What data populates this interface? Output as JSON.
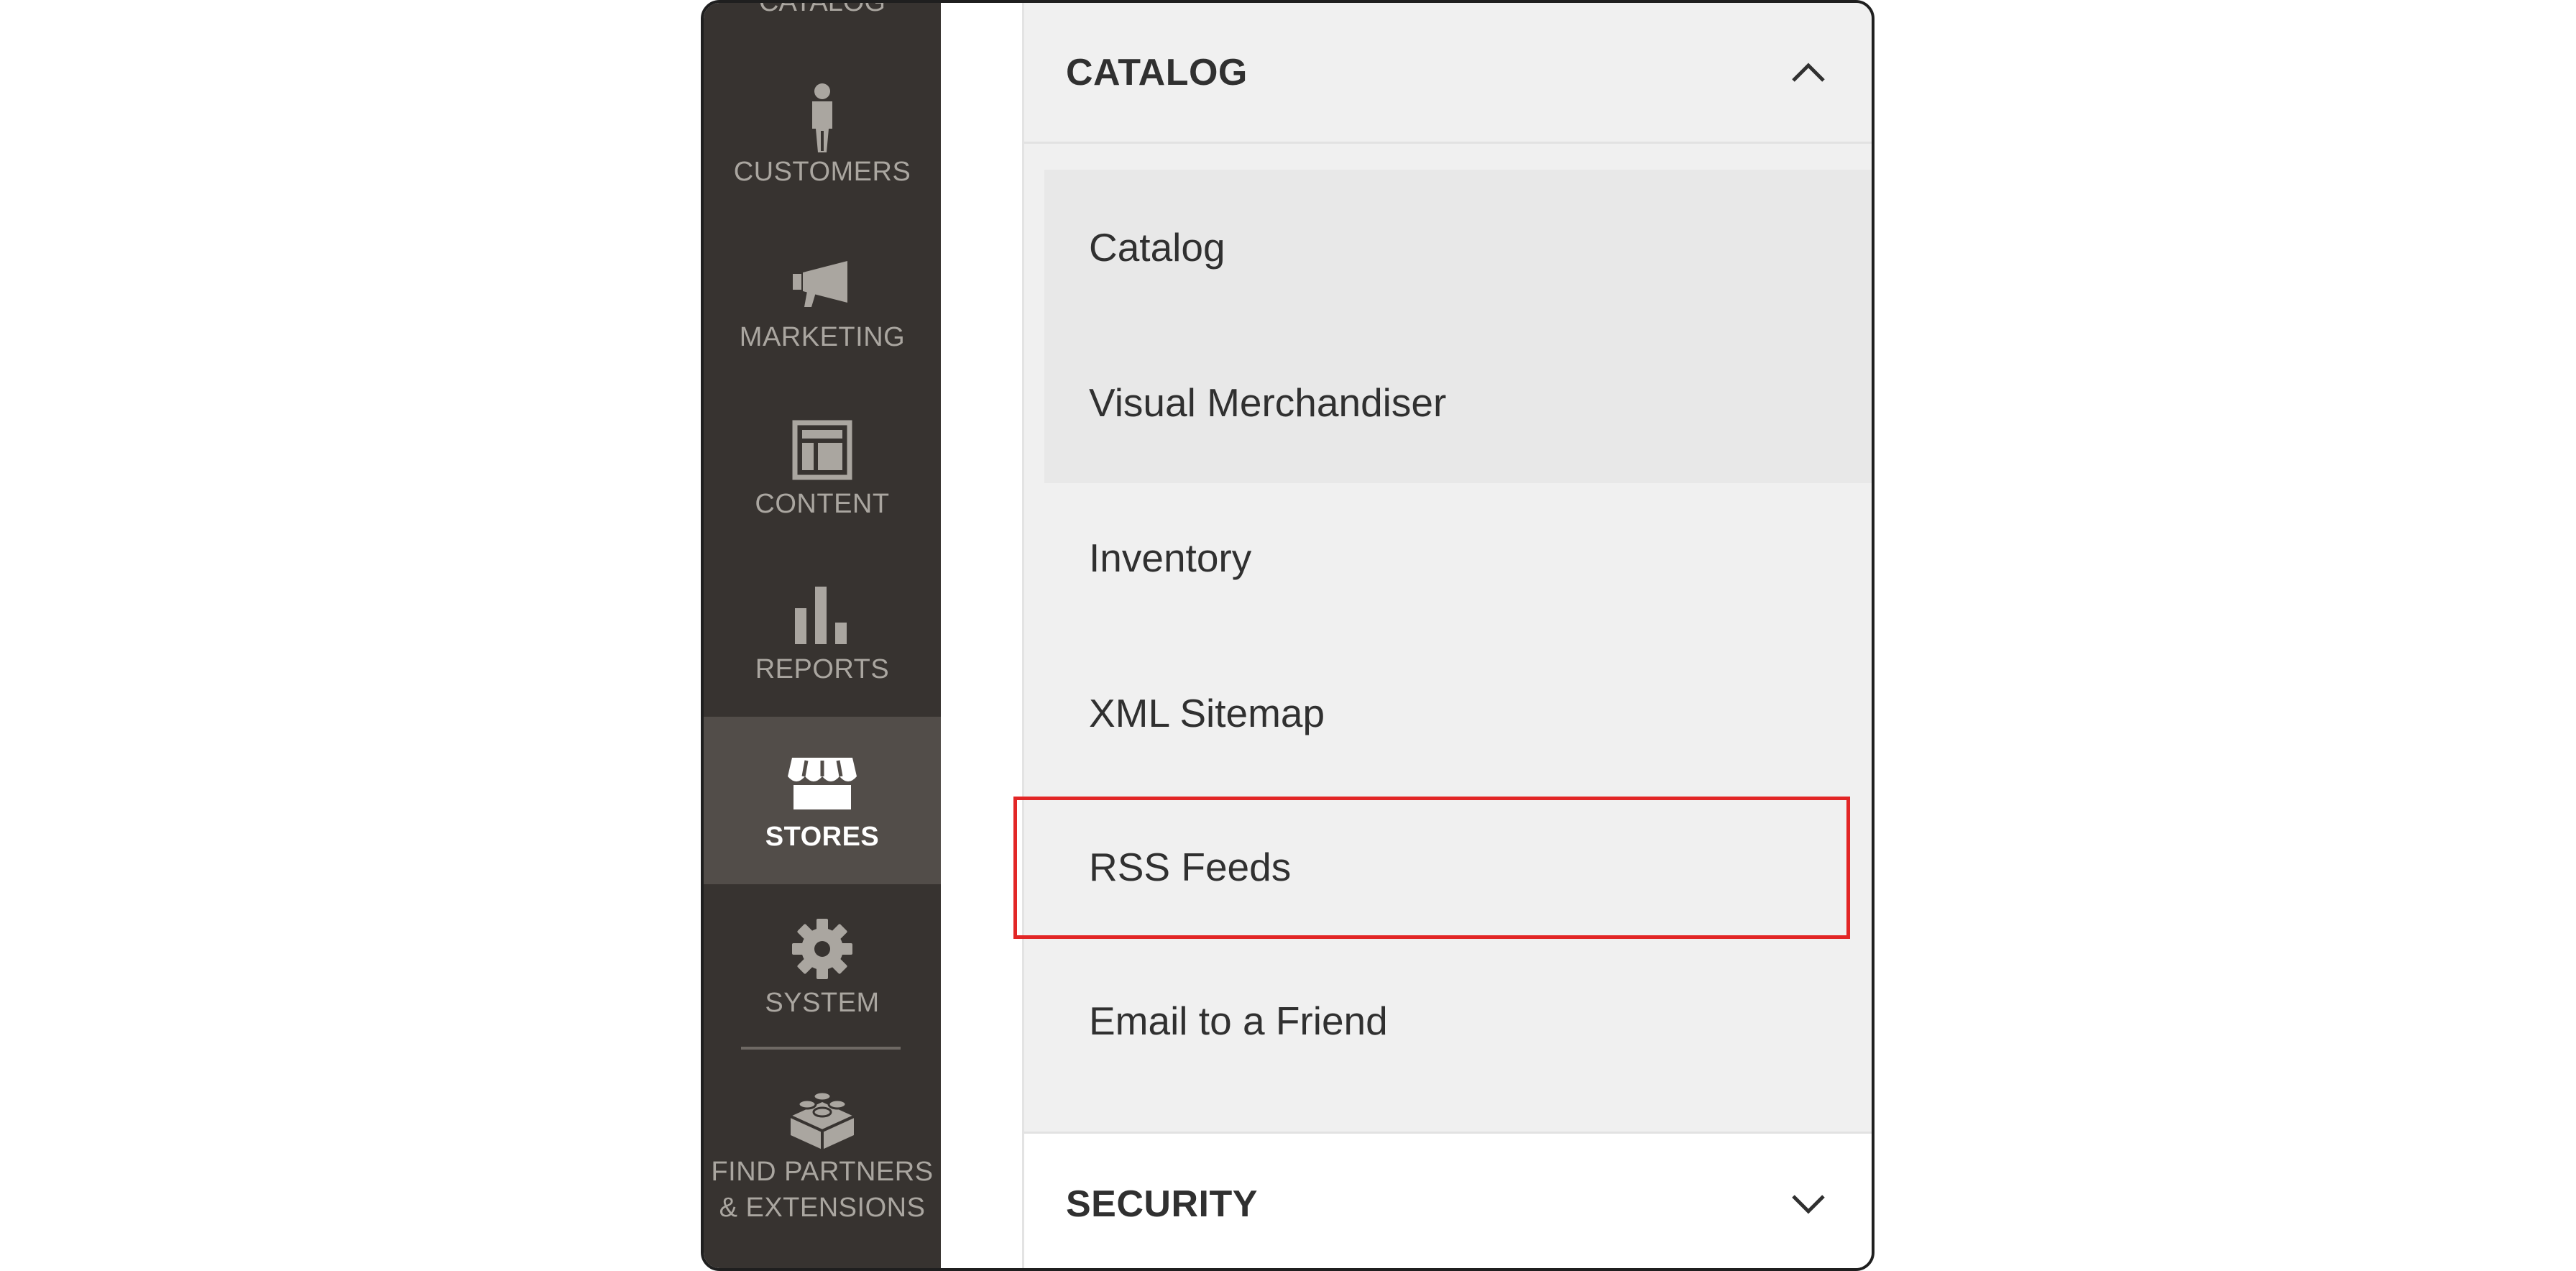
{
  "sidebar": {
    "cut_top_label": "CATALOG",
    "items": [
      {
        "label": "CUSTOMERS",
        "icon": "customer-person-icon",
        "active": false
      },
      {
        "label": "MARKETING",
        "icon": "megaphone-icon",
        "active": false
      },
      {
        "label": "CONTENT",
        "icon": "content-layout-icon",
        "active": false
      },
      {
        "label": "REPORTS",
        "icon": "bar-chart-icon",
        "active": false
      },
      {
        "label": "STORES",
        "icon": "storefront-icon",
        "active": true
      },
      {
        "label": "SYSTEM",
        "icon": "gear-icon",
        "active": false
      },
      {
        "label": "FIND PARTNERS & EXTENSIONS",
        "label_line1": "FIND PARTNERS",
        "label_line2": "& EXTENSIONS",
        "icon": "lego-block-icon",
        "active": false
      }
    ]
  },
  "panel": {
    "catalog_section": {
      "title": "CATALOG",
      "state": "expanded",
      "icon": "chevron-up-icon"
    },
    "items": [
      {
        "label": "Catalog"
      },
      {
        "label": "Visual Merchandiser"
      },
      {
        "label": "Inventory"
      },
      {
        "label": "XML Sitemap"
      },
      {
        "label": "RSS Feeds",
        "highlighted": true
      },
      {
        "label": "Email to a Friend"
      }
    ],
    "security_section": {
      "title": "SECURITY",
      "state": "collapsed",
      "icon": "chevron-down-icon"
    }
  },
  "colors": {
    "sidebar_bg": "#373330",
    "sidebar_active_bg": "#524d49",
    "panel_bg": "#f0f0f0",
    "highlight_border": "#e22626"
  }
}
